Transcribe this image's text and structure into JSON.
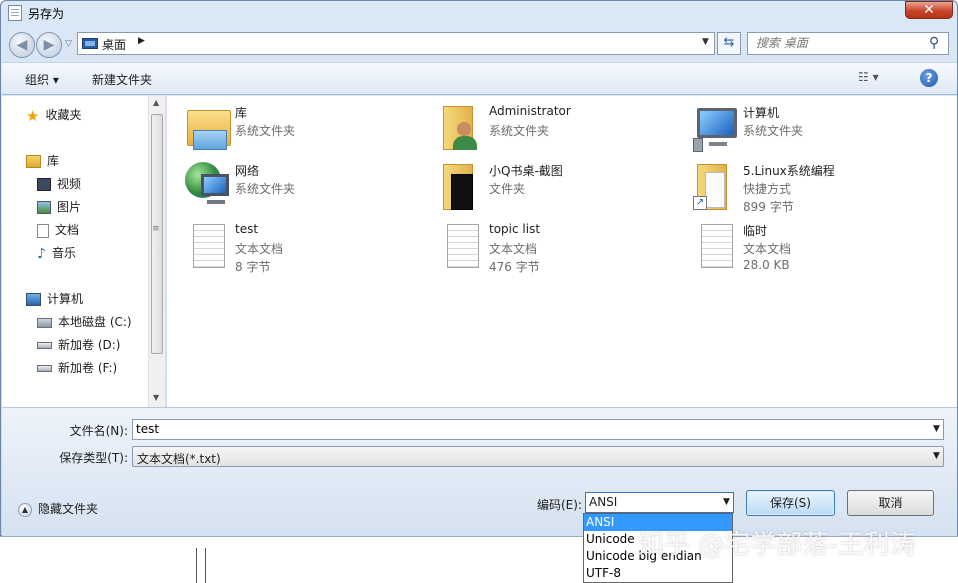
{
  "window": {
    "title": "另存为",
    "close_glyph": "✕"
  },
  "address": {
    "location": "桌面",
    "search_placeholder": "搜索 桌面"
  },
  "toolbar": {
    "organize": "组织 ▾",
    "new_folder": "新建文件夹",
    "view_glyph": "☷ ▾",
    "help_glyph": "?"
  },
  "nav": {
    "favorites": "收藏夹",
    "libraries": "库",
    "videos": "视频",
    "pictures": "图片",
    "documents": "文档",
    "music": "音乐",
    "computer": "计算机",
    "drive_c": "本地磁盘 (C:)",
    "drive_d": "新加卷 (D:)",
    "drive_f": "新加卷 (F:)"
  },
  "files": [
    {
      "name": "库",
      "line2": "系统文件夹",
      "line3": "",
      "icon": "library-icon"
    },
    {
      "name": "Administrator",
      "line2": "系统文件夹",
      "line3": "",
      "icon": "user-folder-icon"
    },
    {
      "name": "计算机",
      "line2": "系统文件夹",
      "line3": "",
      "icon": "computer-icon"
    },
    {
      "name": "网络",
      "line2": "系统文件夹",
      "line3": "",
      "icon": "network-icon"
    },
    {
      "name": "小Q书桌-截图",
      "line2": "文件夹",
      "line3": "",
      "icon": "folder-icon"
    },
    {
      "name": "5.Linux系统编程",
      "line2": "快捷方式",
      "line3": "899 字节",
      "icon": "shortcut-folder-icon"
    },
    {
      "name": "test",
      "line2": "文本文档",
      "line3": "8 字节",
      "icon": "text-document-icon"
    },
    {
      "name": "topic list",
      "line2": "文本文档",
      "line3": "476 字节",
      "icon": "text-document-icon"
    },
    {
      "name": "临时",
      "line2": "文本文档",
      "line3": "28.0 KB",
      "icon": "text-document-icon"
    }
  ],
  "form": {
    "filename_label": "文件名(N):",
    "filename_value": "test",
    "filetype_label": "保存类型(T):",
    "filetype_value": "文本文档(*.txt)",
    "hide_folders": "隐藏文件夹",
    "encoding_label": "编码(E):",
    "encoding_value": "ANSI",
    "save": "保存(S)",
    "cancel": "取消"
  },
  "encoding_options": [
    "ANSI",
    "Unicode",
    "Unicode big endian",
    "UTF-8"
  ],
  "selected_encoding_index": 0,
  "watermark": "知乎 @宅学部落-王利涛",
  "colors": {
    "selection": "#3399ff",
    "close_button": "#c9452c",
    "save_button_border": "#3c7fb1"
  }
}
